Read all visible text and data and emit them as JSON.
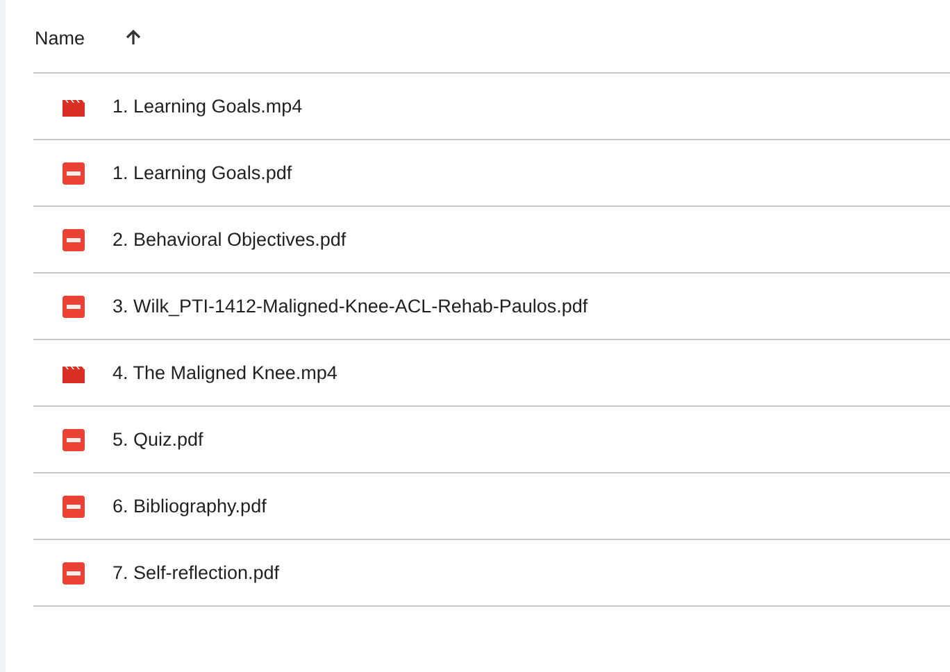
{
  "header": {
    "name_column": "Name"
  },
  "files": [
    {
      "name": "1. Learning Goals.mp4",
      "kind": "video"
    },
    {
      "name": "1. Learning Goals.pdf",
      "kind": "pdf"
    },
    {
      "name": "2. Behavioral Objectives.pdf",
      "kind": "pdf"
    },
    {
      "name": "3. Wilk_PTI-1412-Maligned-Knee-ACL-Rehab-Paulos.pdf",
      "kind": "pdf"
    },
    {
      "name": "4. The Maligned Knee.mp4",
      "kind": "video"
    },
    {
      "name": "5. Quiz.pdf",
      "kind": "pdf"
    },
    {
      "name": "6. Bibliography.pdf",
      "kind": "pdf"
    },
    {
      "name": "7. Self-reflection.pdf",
      "kind": "pdf"
    }
  ]
}
